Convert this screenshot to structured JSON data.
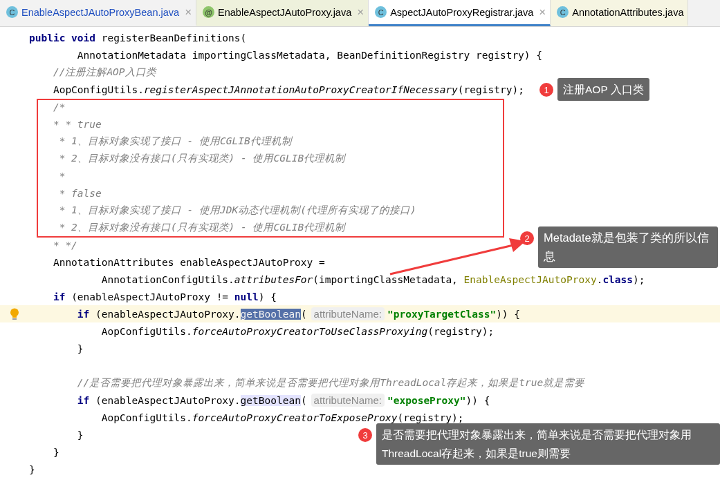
{
  "tabs": [
    {
      "label": "EnableAspectJAutoProxyBean.java",
      "kind": "class",
      "icon": "C",
      "selected": false,
      "modified": true,
      "color": "#f2f2f2",
      "close": "×"
    },
    {
      "label": "EnableAspectJAutoProxy.java",
      "kind": "annotation",
      "icon": "@",
      "selected": false,
      "modified": false,
      "color": "#eef1dc",
      "close": "×"
    },
    {
      "label": "AspectJAutoProxyRegistrar.java",
      "kind": "class",
      "icon": "C",
      "selected": true,
      "modified": false,
      "color": "#ffffff",
      "close": "×"
    },
    {
      "label": "AnnotationAttributes.java",
      "kind": "class",
      "icon": "C",
      "selected": false,
      "modified": false,
      "color": "#f6f5e2"
    }
  ],
  "code_lines": [
    {
      "current": false,
      "tokens": [
        {
          "text": "public void",
          "kind": "keyword"
        },
        {
          "text": " registerBeanDefinitions(",
          "kind": "plain"
        }
      ]
    },
    {
      "current": false,
      "tokens": [
        {
          "text": "        AnnotationMetadata importingClassMetadata, BeanDefinitionRegistry registry) {",
          "kind": "plain"
        }
      ]
    },
    {
      "current": false,
      "tokens": [
        {
          "text": "    //注册注解AOP入口类",
          "kind": "comment"
        }
      ]
    },
    {
      "current": false,
      "tokens": [
        {
          "text": "    AopConfigUtils.",
          "kind": "plain"
        },
        {
          "text": "registerAspectJAnnotationAutoProxyCreatorIfNecessary",
          "kind": "static"
        },
        {
          "text": "(registry);",
          "kind": "plain"
        }
      ]
    },
    {
      "current": false,
      "tokens": [
        {
          "text": "    /*",
          "kind": "comment"
        }
      ]
    },
    {
      "current": false,
      "tokens": [
        {
          "text": "    * * true",
          "kind": "comment"
        }
      ]
    },
    {
      "current": false,
      "tokens": [
        {
          "text": "     * 1、目标对象实现了接口 - 使用CGLIB代理机制",
          "kind": "comment"
        }
      ]
    },
    {
      "current": false,
      "tokens": [
        {
          "text": "     * 2、目标对象没有接口(只有实现类) - 使用CGLIB代理机制",
          "kind": "comment"
        }
      ]
    },
    {
      "current": false,
      "tokens": [
        {
          "text": "     *",
          "kind": "comment"
        }
      ]
    },
    {
      "current": false,
      "tokens": [
        {
          "text": "     * false",
          "kind": "comment"
        }
      ]
    },
    {
      "current": false,
      "tokens": [
        {
          "text": "     * 1、目标对象实现了接口 - 使用JDK动态代理机制(代理所有实现了的接口)",
          "kind": "comment"
        }
      ]
    },
    {
      "current": false,
      "tokens": [
        {
          "text": "     * 2、目标对象没有接口(只有实现类) - 使用CGLIB代理机制",
          "kind": "comment"
        }
      ]
    },
    {
      "current": false,
      "tokens": [
        {
          "text": "    * */",
          "kind": "comment"
        }
      ]
    },
    {
      "current": false,
      "tokens": [
        {
          "text": "    AnnotationAttributes enableAspectJAutoProxy =",
          "kind": "plain"
        }
      ]
    },
    {
      "current": false,
      "tokens": [
        {
          "text": "            AnnotationConfigUtils.",
          "kind": "plain"
        },
        {
          "text": "attributesFor",
          "kind": "static"
        },
        {
          "text": "(importingClassMetadata,",
          "kind": "plain"
        },
        {
          "text": " EnableAspectJAutoProxy",
          "kind": "class-ref"
        },
        {
          "text": ".",
          "kind": "plain"
        },
        {
          "text": "class",
          "kind": "keyword"
        },
        {
          "text": ");",
          "kind": "plain"
        }
      ]
    },
    {
      "current": false,
      "tokens": [
        {
          "text": "    if",
          "kind": "keyword"
        },
        {
          "text": " (enableAspectJAutoProxy != ",
          "kind": "plain"
        },
        {
          "text": "null",
          "kind": "keyword"
        },
        {
          "text": ") {",
          "kind": "plain"
        }
      ]
    },
    {
      "current": true,
      "tokens": [
        {
          "text": "        if",
          "kind": "keyword"
        },
        {
          "text": " (enableAspectJAutoProxy.",
          "kind": "plain"
        },
        {
          "text": "getBoolean",
          "kind": "selection"
        },
        {
          "text": "(",
          "kind": "plain"
        },
        {
          "text": "attributeName:",
          "kind": "hint"
        },
        {
          "text": "\"proxyTargetClass\"",
          "kind": "string"
        },
        {
          "text": ")) {",
          "kind": "plain"
        }
      ]
    },
    {
      "current": false,
      "tokens": [
        {
          "text": "            AopConfigUtils.",
          "kind": "plain"
        },
        {
          "text": "forceAutoProxyCreatorToUseClassProxying",
          "kind": "static"
        },
        {
          "text": "(registry);",
          "kind": "plain"
        }
      ]
    },
    {
      "current": false,
      "tokens": [
        {
          "text": "        }",
          "kind": "plain"
        }
      ]
    },
    {
      "current": false
    },
    {
      "current": false,
      "tokens": [
        {
          "text": "        //是否需要把代理对象暴露出来，简单来说是否需要把代理对象用ThreadLocal存起来，如果是true就是需要",
          "kind": "comment"
        }
      ]
    },
    {
      "current": false,
      "tokens": [
        {
          "text": "        if",
          "kind": "keyword"
        },
        {
          "text": " (enableAspectJAutoProxy.",
          "kind": "plain"
        },
        {
          "text": "getBoolean",
          "kind": "usage"
        },
        {
          "text": "(",
          "kind": "plain"
        },
        {
          "text": "attributeName:",
          "kind": "hint"
        },
        {
          "text": "\"exposeProxy\"",
          "kind": "string"
        },
        {
          "text": ")) {",
          "kind": "plain"
        }
      ]
    },
    {
      "current": false,
      "tokens": [
        {
          "text": "            AopConfigUtils.",
          "kind": "plain"
        },
        {
          "text": "forceAutoProxyCreatorToExposeProxy",
          "kind": "static"
        },
        {
          "text": "(registry);",
          "kind": "plain"
        }
      ]
    },
    {
      "current": false,
      "tokens": [
        {
          "text": "        }",
          "kind": "plain"
        }
      ]
    },
    {
      "current": false,
      "tokens": [
        {
          "text": "    }",
          "kind": "plain"
        }
      ]
    },
    {
      "current": false,
      "tokens": [
        {
          "text": "}",
          "kind": "plain"
        }
      ]
    }
  ],
  "annotations": [
    {
      "number": "1",
      "text": "注册AOP 入口类"
    },
    {
      "number": "2",
      "text": "Metadate就是包装了类的所以信息"
    },
    {
      "number": "3",
      "text": "是否需要把代理对象暴露出来，简单来说是否需要把代理对象用ThreadLocal存起来，如果是true则需要"
    }
  ]
}
